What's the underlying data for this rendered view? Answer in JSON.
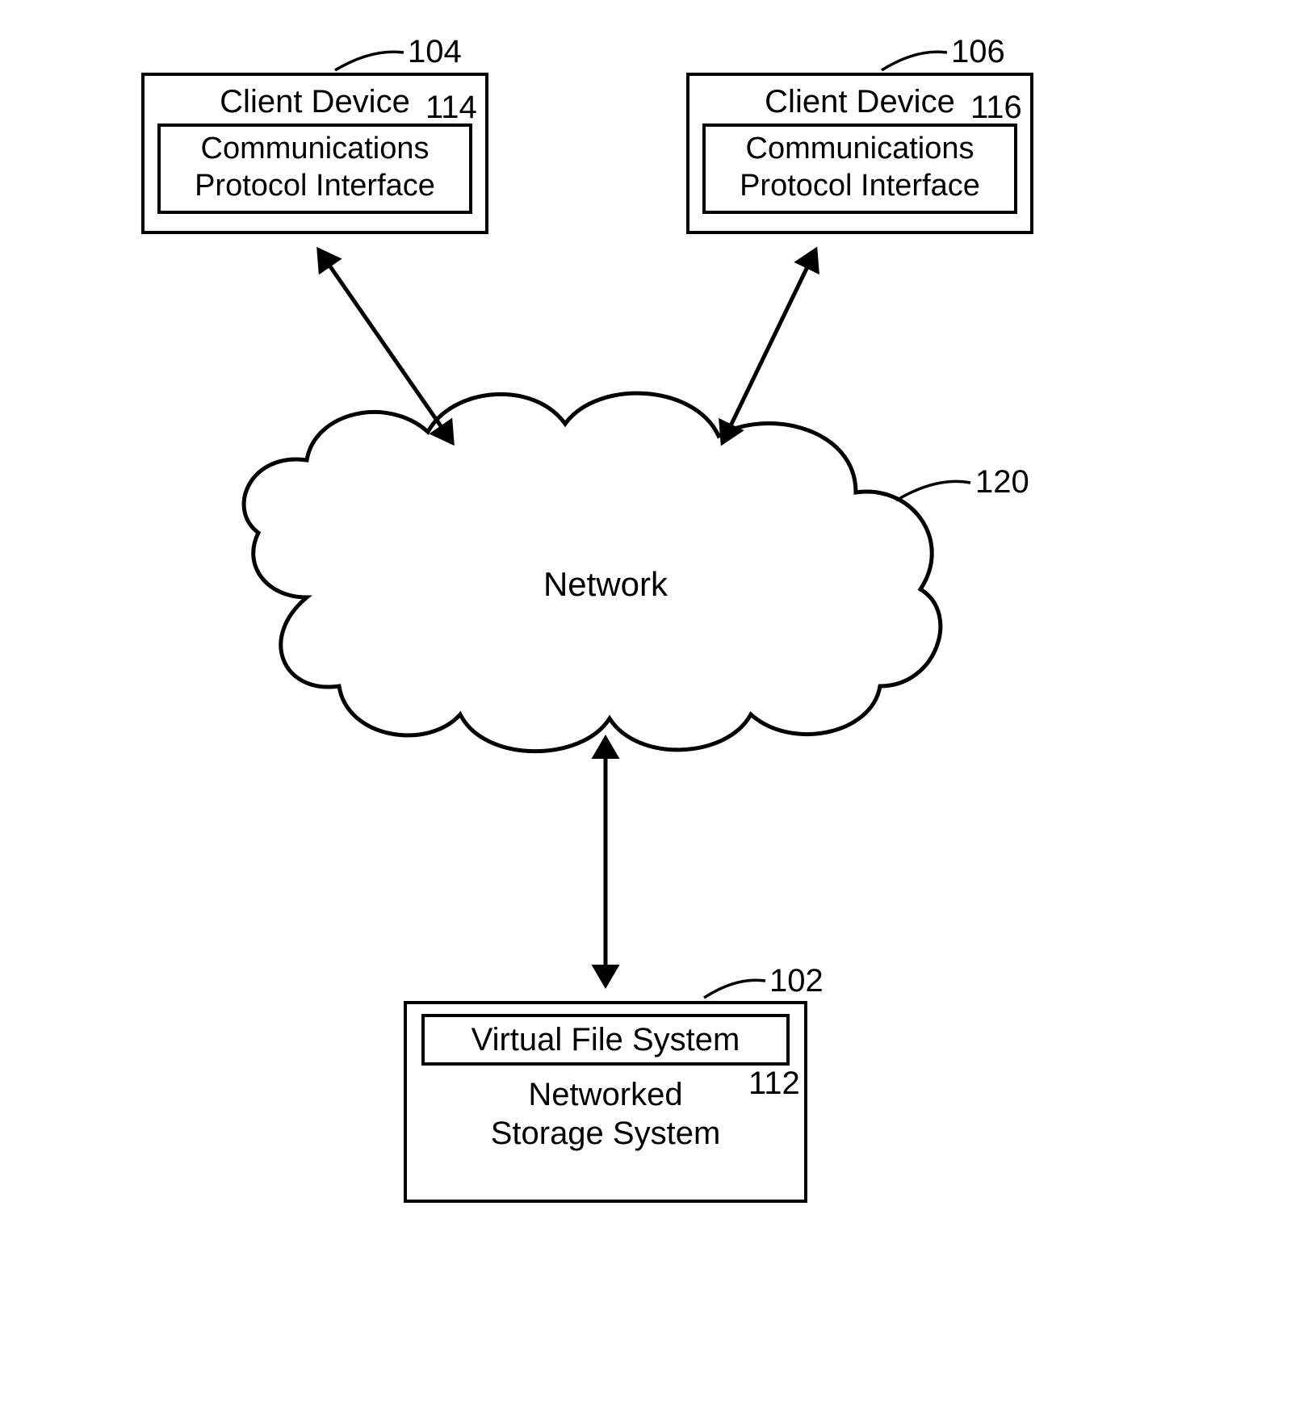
{
  "refs": {
    "client_left_outer": "104",
    "client_left_inner": "114",
    "client_right_outer": "106",
    "client_right_inner": "116",
    "cloud": "120",
    "storage_outer": "102",
    "storage_inner": "112"
  },
  "client_left": {
    "title": "Client Device",
    "inner_line1": "Communications",
    "inner_line2": "Protocol Interface"
  },
  "client_right": {
    "title": "Client Device",
    "inner_line1": "Communications",
    "inner_line2": "Protocol Interface"
  },
  "cloud": {
    "label": "Network"
  },
  "storage": {
    "inner": "Virtual File System",
    "title_line1": "Networked",
    "title_line2": "Storage System"
  }
}
